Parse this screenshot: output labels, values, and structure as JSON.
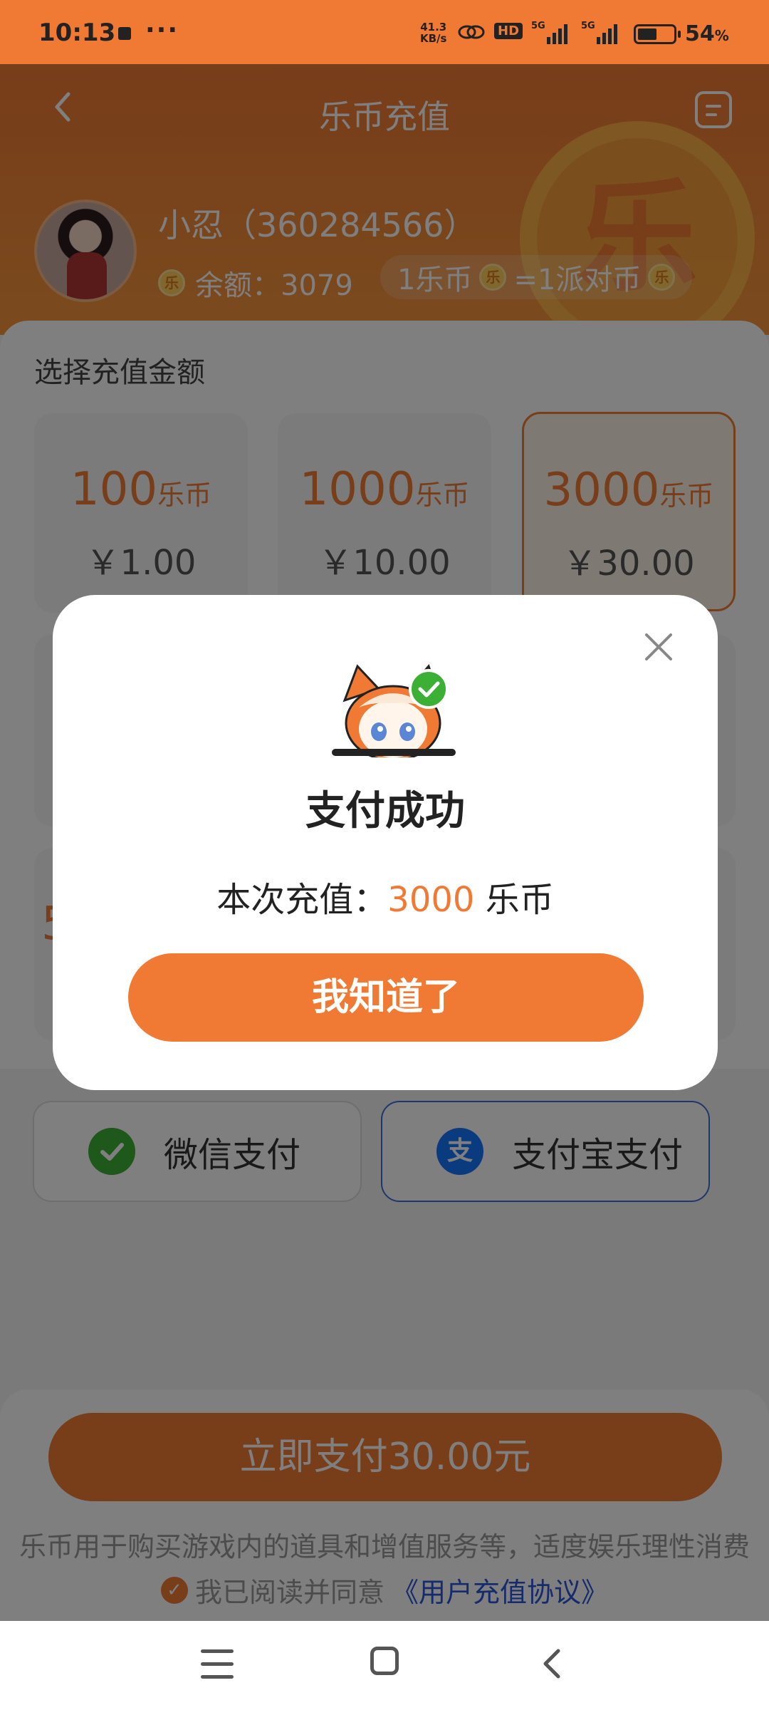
{
  "status_bar": {
    "time": "10:13",
    "more": "···",
    "speed": "41.3",
    "speed_unit": "KB/s",
    "hd": "HD",
    "network1": "5G",
    "network2": "5G",
    "battery_pct": "54",
    "battery_unit": "%",
    "battery_level": 0.54
  },
  "header": {
    "title": "乐币充值",
    "coin_glyph": "乐"
  },
  "user": {
    "name": "小忍（360284566）",
    "balance_label": "余额：3079",
    "rate_left": "1乐币",
    "rate_right": "=1派对币"
  },
  "coin_glyph": "乐",
  "recharge": {
    "section_label": "选择充值金额",
    "unit": "乐币",
    "packages": [
      {
        "amount": "100",
        "price": "￥1.00",
        "selected": false
      },
      {
        "amount": "1000",
        "price": "￥10.00",
        "selected": false
      },
      {
        "amount": "3000",
        "price": "￥30.00",
        "selected": true
      }
    ],
    "partial_amount_digit": "5"
  },
  "payment": {
    "methods": [
      {
        "label": "微信支付",
        "icon": "wechat-icon",
        "active": false
      },
      {
        "label": "支付宝支付",
        "icon": "alipay-icon",
        "active": true
      }
    ],
    "alipay_glyph": "支"
  },
  "footer": {
    "pay_button": "立即支付30.00元",
    "notice": "乐币用于购买游戏内的道具和增值服务等，适度娱乐理性消费",
    "agree_prefix": "我已阅读并同意",
    "agree_link": "《用户充值协议》"
  },
  "dialog": {
    "title": "支付成功",
    "msg_prefix": "本次充值：",
    "msg_amount": "3000",
    "msg_unit": " 乐币",
    "ok_button": "我知道了"
  },
  "colors": {
    "accent": "#f07a33",
    "link": "#2d56d8",
    "wechat": "#3cb034",
    "alipay": "#1677ff"
  }
}
